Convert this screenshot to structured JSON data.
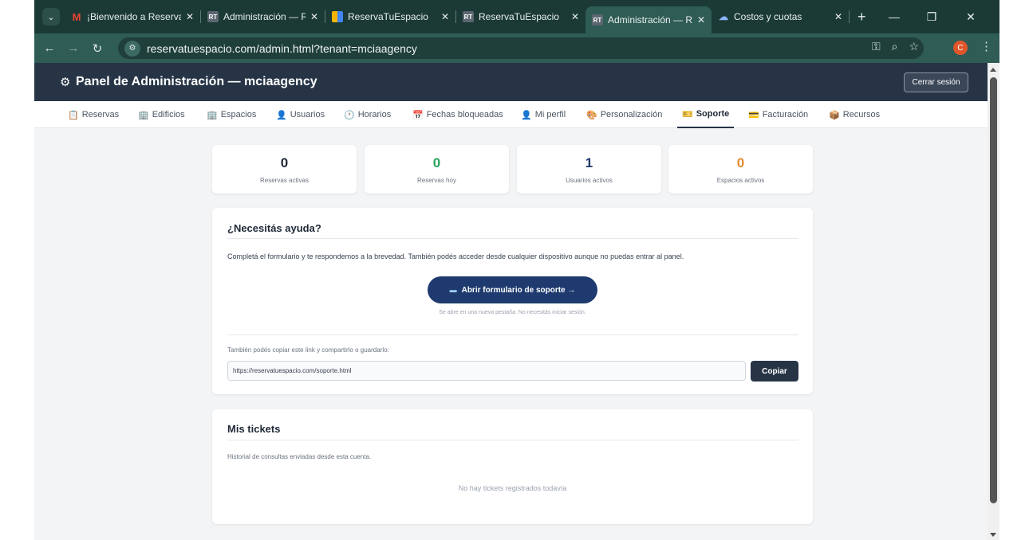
{
  "browser": {
    "tabs": [
      {
        "title": "¡Bienvenido a Reserva",
        "icon": "gmail-icon"
      },
      {
        "title": "Administración — Re",
        "icon": "rt-icon"
      },
      {
        "title": "ReservaTuEspacio",
        "icon": "grid-icon"
      },
      {
        "title": "ReservaTuEspacio",
        "icon": "rt-icon"
      },
      {
        "title": "Administración — Re",
        "icon": "rt-icon"
      },
      {
        "title": "Costos y cuotas",
        "icon": "cloud-icon"
      }
    ],
    "active_tab": 4,
    "url": "reservatuespacio.com/admin.html?tenant=mciaagency",
    "profile_initial": "C"
  },
  "header": {
    "title": "Panel de Administración — mciaagency",
    "logout_label": "Cerrar sesión"
  },
  "nav": {
    "tabs": [
      {
        "label": "Reservas"
      },
      {
        "label": "Edificios"
      },
      {
        "label": "Espacios"
      },
      {
        "label": "Usuarios"
      },
      {
        "label": "Horarios"
      },
      {
        "label": "Fechas bloqueadas"
      },
      {
        "label": "Mi perfil"
      },
      {
        "label": "Personalización"
      },
      {
        "label": "Soporte"
      },
      {
        "label": "Facturación"
      },
      {
        "label": "Recursos"
      }
    ],
    "active": "Soporte"
  },
  "stats": [
    {
      "value": "0",
      "label": "Reservas activas",
      "color": "#1f2937"
    },
    {
      "value": "0",
      "label": "Reservas hoy",
      "color": "#22a35a"
    },
    {
      "value": "1",
      "label": "Usuarios activos",
      "color": "#1e3a6e"
    },
    {
      "value": "0",
      "label": "Espacios activos",
      "color": "#e08a2c"
    }
  ],
  "help": {
    "title": "¿Necesitás ayuda?",
    "description": "Completá el formulario y te respondemos a la brevedad. También podés acceder desde cualquier dispositivo aunque no puedas entrar al panel.",
    "button_label": "Abrir formulario de soporte →",
    "button_note": "Se abre en una nueva pestaña. No necesitás iniciar sesión.",
    "copy_label": "También podés copiar este link y compartirlo o guardarlo:",
    "link_value": "https://reservatuespacio.com/soporte.html",
    "copy_button": "Copiar"
  },
  "tickets": {
    "title": "Mis tickets",
    "subtitle": "Historial de consultas enviadas desde esta cuenta.",
    "empty": "No hay tickets registrados todavía"
  }
}
